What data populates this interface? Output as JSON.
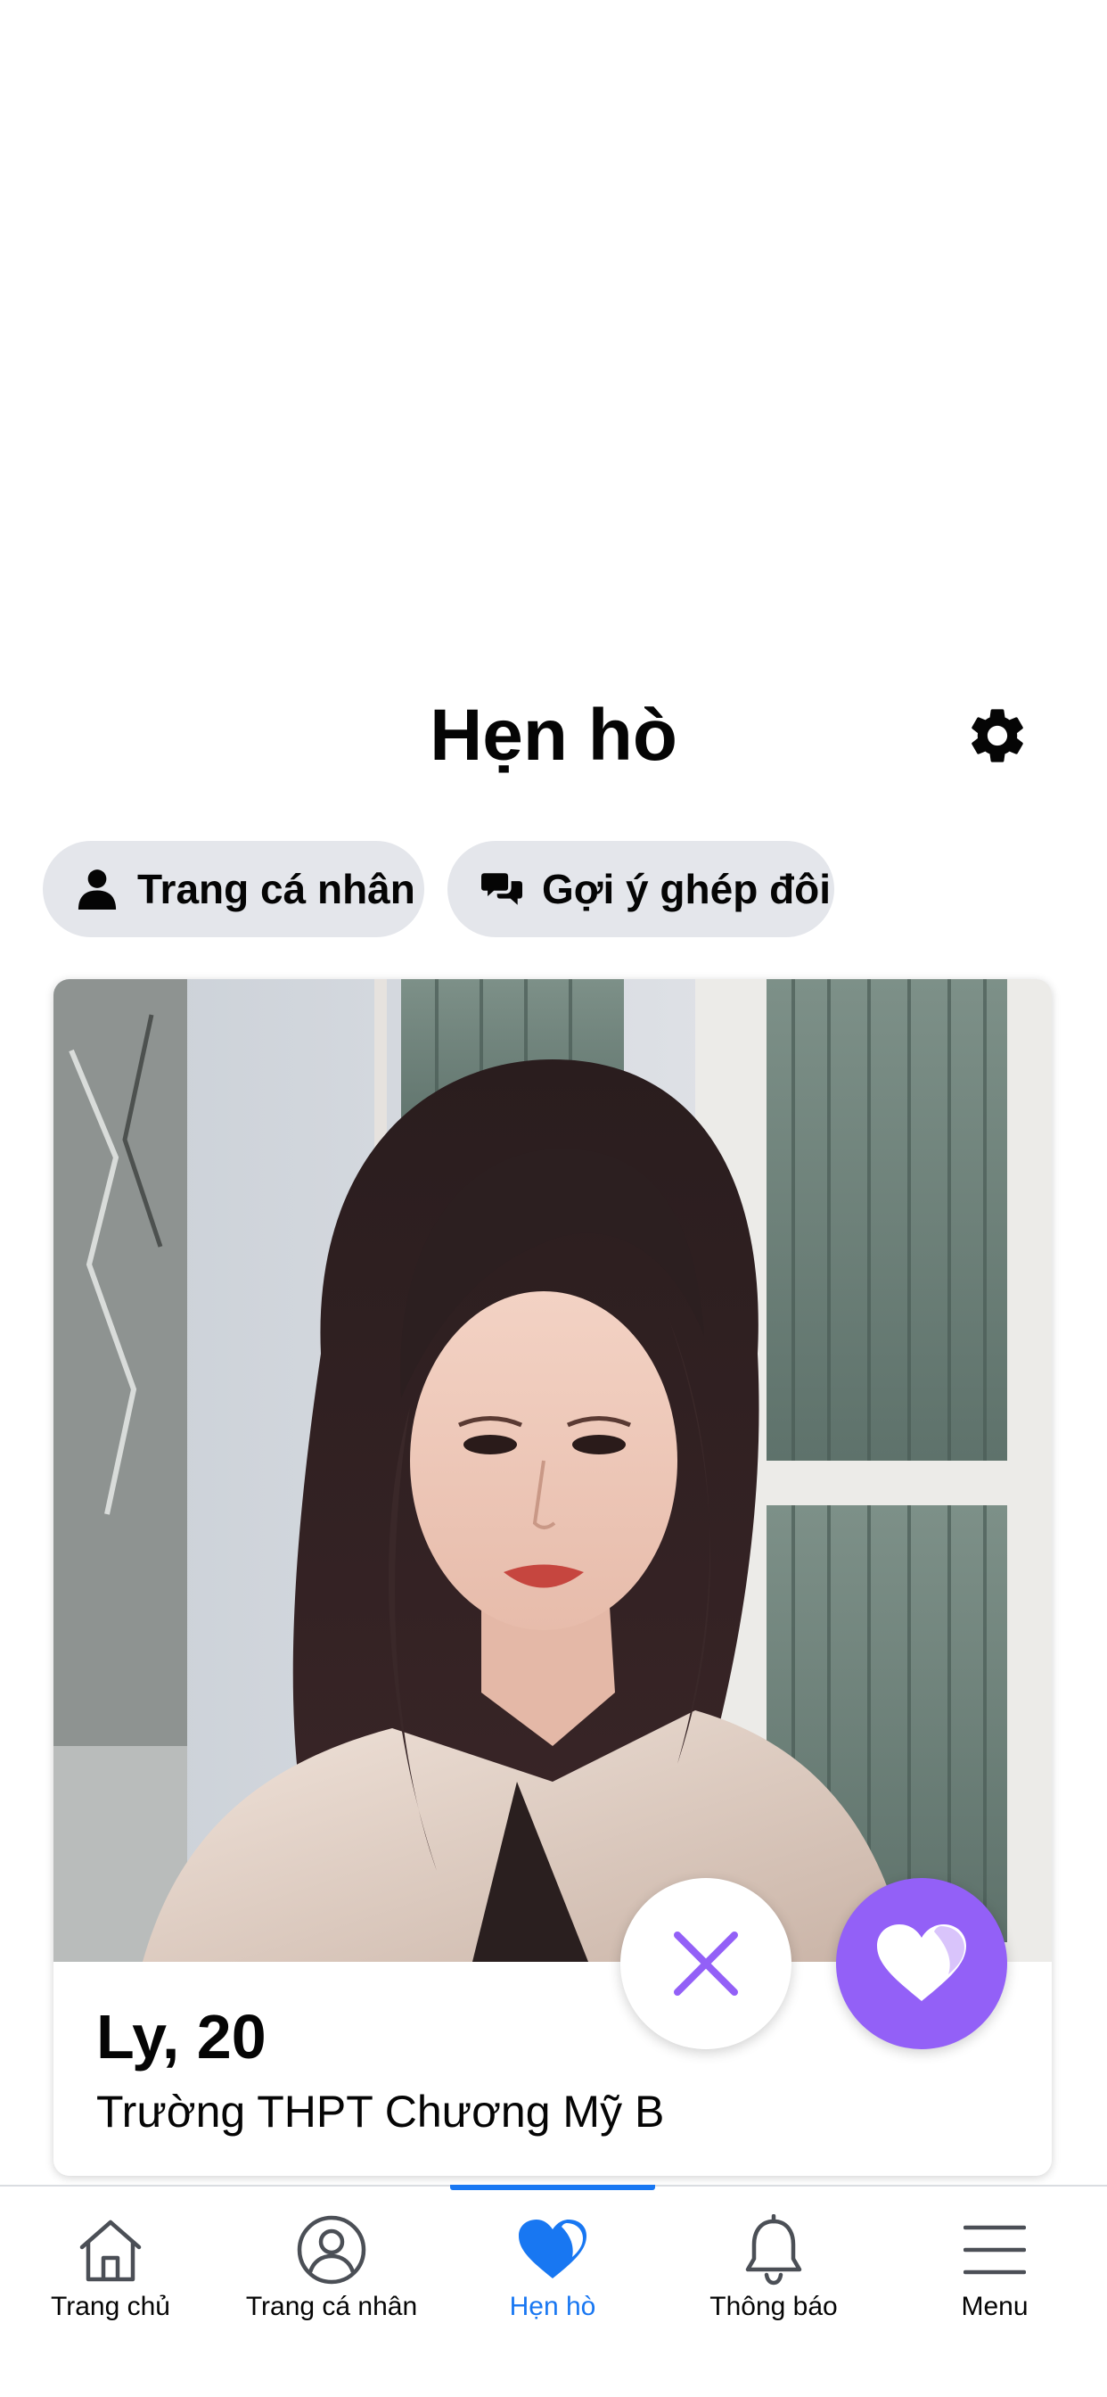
{
  "header": {
    "title": "Hẹn hò",
    "settings_icon": "gear-icon"
  },
  "pills": [
    {
      "label": "Trang cá nhân",
      "icon": "person-icon"
    },
    {
      "label": "Gợi ý ghép đôi",
      "icon": "chat-bubbles-icon"
    }
  ],
  "profile_card": {
    "name_age": "Ly, 20",
    "school": "Trường THPT Chương Mỹ B",
    "photo": "profile-photo"
  },
  "actions": {
    "pass_icon": "close-icon",
    "like_icon": "heart-icon",
    "like_color": "#9360f7",
    "pass_color": "#9360f7"
  },
  "bottom_nav": {
    "active_color": "#1877f2",
    "items": [
      {
        "label": "Trang chủ",
        "icon": "home-icon",
        "active": false
      },
      {
        "label": "Trang cá nhân",
        "icon": "profile-icon",
        "active": false
      },
      {
        "label": "Hẹn hò",
        "icon": "dating-heart-icon",
        "active": true
      },
      {
        "label": "Thông báo",
        "icon": "bell-icon",
        "active": false
      },
      {
        "label": "Menu",
        "icon": "menu-icon",
        "active": false
      }
    ]
  }
}
